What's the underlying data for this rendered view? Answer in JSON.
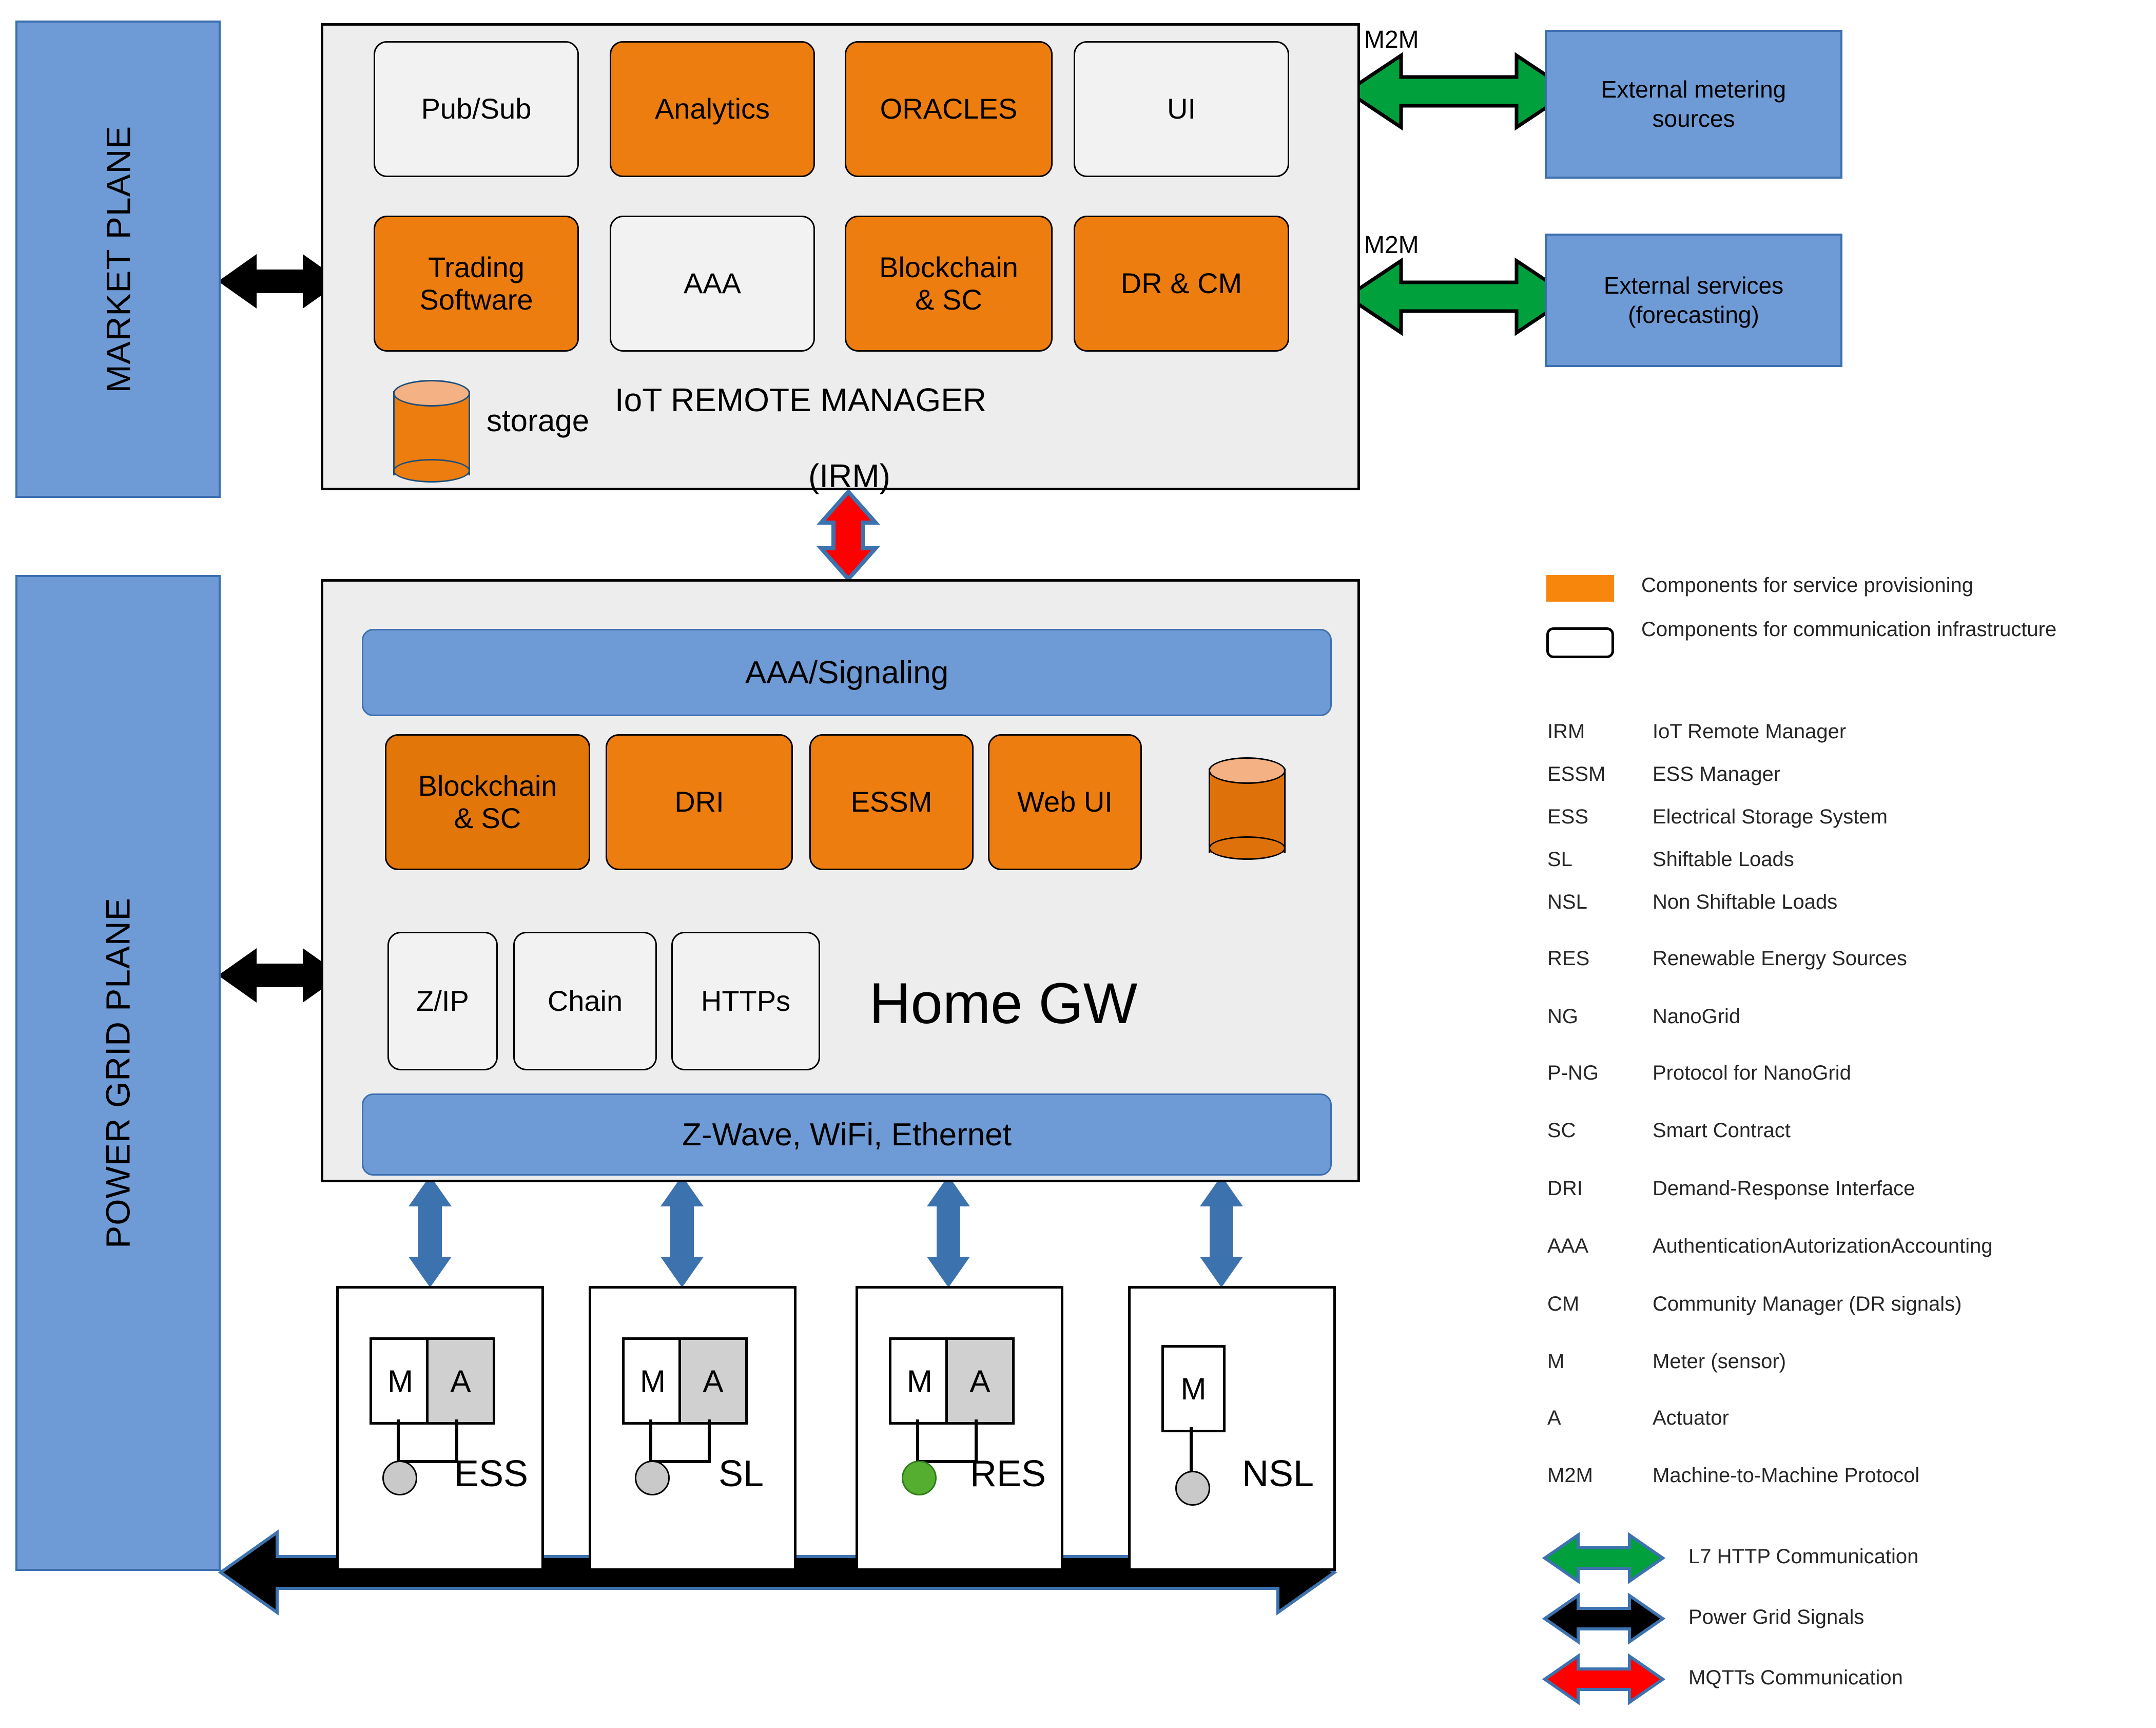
{
  "planes": {
    "market": "MARKET PLANE",
    "power_grid": "POWER GRID PLANE"
  },
  "irm": {
    "title_line1": "IoT REMOTE MANAGER",
    "title_line2": "(IRM)",
    "storage_label": "storage",
    "row1": [
      {
        "label": "Pub/Sub",
        "kind": "communication"
      },
      {
        "label": "Analytics",
        "kind": "service"
      },
      {
        "label": "ORACLES",
        "kind": "service"
      },
      {
        "label": "UI",
        "kind": "communication"
      }
    ],
    "row2": [
      {
        "label": "Trading\nSoftware",
        "line1": "Trading",
        "line2": "Software",
        "kind": "service"
      },
      {
        "label": "AAA",
        "line1": "AAA",
        "line2": "",
        "kind": "communication"
      },
      {
        "label": "Blockchain\n& SC",
        "line1": "Blockchain",
        "line2": "& SC",
        "kind": "service"
      },
      {
        "label": "DR & CM",
        "line1": "DR & CM",
        "line2": "",
        "kind": "service"
      }
    ]
  },
  "home_gw": {
    "title": "Home GW",
    "top_bar": "AAA/Signaling",
    "bottom_bar": "Z-Wave, WiFi, Ethernet",
    "service_modules": [
      {
        "line1": "Blockchain",
        "line2": "& SC"
      },
      {
        "line1": "DRI",
        "line2": ""
      },
      {
        "line1": "ESSM",
        "line2": ""
      },
      {
        "line1": "Web UI",
        "line2": ""
      }
    ],
    "comm_modules": [
      {
        "label": "Z/IP"
      },
      {
        "label": "Chain"
      },
      {
        "label": "HTTPs"
      }
    ]
  },
  "external": [
    {
      "m2m": "M2M",
      "line1": "External metering",
      "line2": "sources"
    },
    {
      "m2m": "M2M",
      "line1": "External services",
      "line2": "(forecasting)"
    }
  ],
  "devices": [
    {
      "name": "ESS",
      "meter": "M",
      "actuator": "A",
      "has_actuator": true,
      "dot_color": "grey"
    },
    {
      "name": "SL",
      "meter": "M",
      "actuator": "A",
      "has_actuator": true,
      "dot_color": "grey"
    },
    {
      "name": "RES",
      "meter": "M",
      "actuator": "A",
      "has_actuator": true,
      "dot_color": "green"
    },
    {
      "name": "NSL",
      "meter": "M",
      "actuator": "",
      "has_actuator": false,
      "dot_color": "grey"
    }
  ],
  "legend": {
    "swatches": [
      {
        "type": "orange-fill",
        "label": "Components for service provisioning"
      },
      {
        "type": "white-outline",
        "label": "Components for communication infrastructure"
      }
    ],
    "abbreviations": [
      {
        "abbr": "IRM",
        "definition": "IoT Remote Manager"
      },
      {
        "abbr": "ESSM",
        "definition": "ESS Manager"
      },
      {
        "abbr": "ESS",
        "definition": "Electrical Storage System"
      },
      {
        "abbr": "SL",
        "definition": "Shiftable Loads"
      },
      {
        "abbr": "NSL",
        "definition": "Non Shiftable Loads"
      },
      {
        "abbr": "RES",
        "definition": "Renewable Energy Sources"
      },
      {
        "abbr": "NG",
        "definition": "NanoGrid"
      },
      {
        "abbr": "P-NG",
        "definition": "Protocol for NanoGrid"
      },
      {
        "abbr": "SC",
        "definition": "Smart Contract"
      },
      {
        "abbr": "DRI",
        "definition": "Demand-Response Interface"
      },
      {
        "abbr": "AAA",
        "definition": "AuthenticationAutorizationAccounting"
      },
      {
        "abbr": "CM",
        "definition": "Community Manager (DR signals)"
      },
      {
        "abbr": "M",
        "definition": "Meter (sensor)"
      },
      {
        "abbr": "A",
        "definition": "Actuator"
      },
      {
        "abbr": "M2M",
        "definition": "Machine-to-Machine Protocol"
      }
    ],
    "arrows": [
      {
        "color": "#00A03C",
        "label": "L7 HTTP Communication"
      },
      {
        "color": "#000000",
        "label": "Power Grid Signals"
      },
      {
        "color": "#FF0000",
        "label": "MQTTs Communication"
      }
    ]
  },
  "colors": {
    "service_orange": "#ED7D0E",
    "comm_white": "#F2F2F2",
    "plane_blue": "#6E9BD5",
    "plane_blue_border": "#3C6FB0",
    "container_grey": "#EDEDED",
    "green_arrow": "#00A03C",
    "red_arrow": "#FF0000",
    "black_arrow": "#000000",
    "blue_arrow": "#3C72AE"
  }
}
